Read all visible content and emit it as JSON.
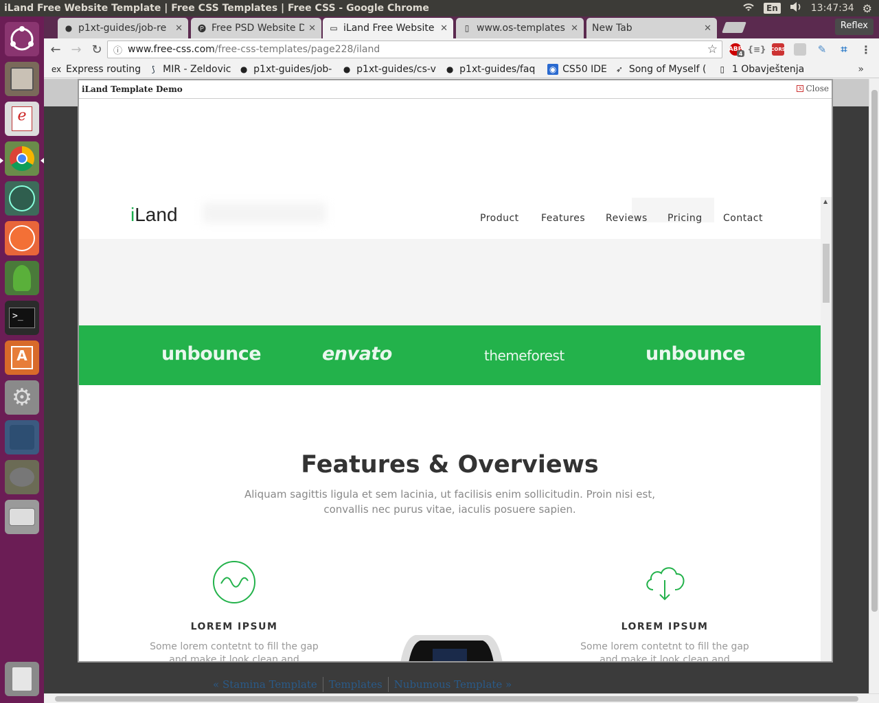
{
  "system_bar": {
    "window_title": "iLand Free Website Template | Free CSS Templates | Free CSS - Google Chrome",
    "lang": "En",
    "time": "13:47:34"
  },
  "launcher": {
    "items": [
      "ubuntu-dash",
      "files",
      "document-viewer",
      "chrome",
      "atom",
      "postman",
      "rocket",
      "terminal",
      "software-center",
      "system-settings",
      "mysql-workbench",
      "gimp",
      "disks"
    ],
    "trash": "trash"
  },
  "tabs": [
    {
      "label": "p1xt-guides/job-re",
      "icon": "github-icon"
    },
    {
      "label": "Free PSD Website D",
      "icon": "psd-icon"
    },
    {
      "label": "iLand Free Website",
      "icon": "page-icon",
      "active": true
    },
    {
      "label": "www.os-templates",
      "icon": "doc-icon"
    },
    {
      "label": "New Tab",
      "icon": ""
    }
  ],
  "reflex": "Reflex",
  "address": {
    "host": "www.free-css.com",
    "path": "/free-css-templates/page228/iland"
  },
  "extensions": {
    "abp_count": "4",
    "cors": "CORS"
  },
  "bookmarks": [
    {
      "label": "Express routing",
      "icon": "ex"
    },
    {
      "label": "MIR - Zeldovich Y",
      "icon": "mir"
    },
    {
      "label": "p1xt-guides/job-",
      "icon": "gh"
    },
    {
      "label": "p1xt-guides/cs-v",
      "icon": "gh"
    },
    {
      "label": "p1xt-guides/faq",
      "icon": "gh"
    },
    {
      "label": "CS50 IDE",
      "icon": "cs50"
    },
    {
      "label": "Song of Myself (",
      "icon": "bird"
    },
    {
      "label": "1 Obavještenja",
      "icon": "doc"
    }
  ],
  "modal": {
    "title": "iLand Template Demo",
    "close": "Close"
  },
  "site": {
    "logo_i": "i",
    "logo_rest": "Land",
    "nav": [
      "Product",
      "Features",
      "Reviews",
      "Pricing",
      "Contact"
    ],
    "partners": [
      "unbounce",
      "envato",
      "themeforest",
      "unbounce"
    ],
    "features_title": "Features & Overviews",
    "features_sub": "Aliquam sagittis ligula et sem lacinia, ut facilisis enim sollicitudin. Proin nisi est, convallis nec purus vitae, iaculis posuere sapien.",
    "features": [
      {
        "heading": "LOREM IPSUM",
        "body": "Some lorem contetnt to fill the gap and make it look clean and organized.",
        "icon": "wave-circle-icon"
      },
      {
        "heading": "LOREM IPSUM",
        "body": "Some lorem contetnt to fill the gap and make it look clean and organized.",
        "icon": "cloud-download-icon"
      }
    ],
    "accent": "#23b24b"
  },
  "page_links": {
    "prev": "« Stamina Template",
    "middle": "Templates",
    "next": "Nubumous Template »"
  }
}
